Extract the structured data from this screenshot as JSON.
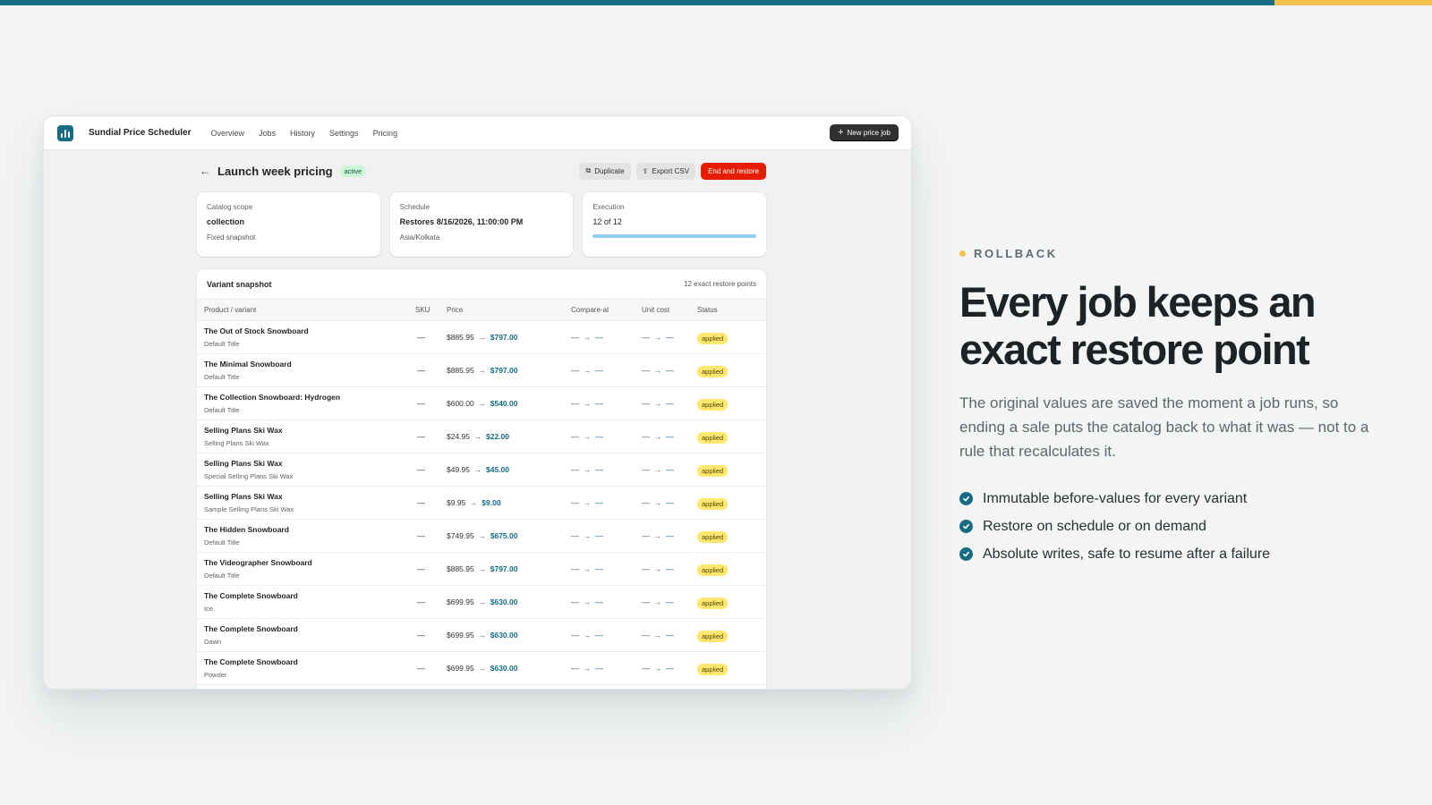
{
  "colors": {
    "brand": "#176b82",
    "accent": "#f2c14e",
    "critical": "#e51c00",
    "active_badge": "#cdf6d8",
    "status_badge": "#ffe770"
  },
  "app": {
    "name": "Sundial Price Scheduler",
    "nav": [
      "Overview",
      "Jobs",
      "History",
      "Settings",
      "Pricing"
    ],
    "new_job_label": "New price job"
  },
  "job": {
    "title": "Launch week pricing",
    "status": "active",
    "actions": {
      "duplicate": "Duplicate",
      "export": "Export CSV",
      "end": "End and restore"
    },
    "cards": {
      "scope": {
        "label": "Catalog scope",
        "value": "collection",
        "sub": "Fixed snapshot"
      },
      "schedule": {
        "label": "Schedule",
        "value": "Restores 8/16/2026, 11:00:00 PM",
        "sub": "Asia/Kolkata"
      },
      "execution": {
        "label": "Execution",
        "value": "12 of 12",
        "progress": 1.0
      }
    }
  },
  "snapshot": {
    "title": "Variant snapshot",
    "count": "12 exact restore points",
    "columns": {
      "product": "Product / variant",
      "sku": "SKU",
      "price": "Price",
      "compare": "Compare-at",
      "cost": "Unit cost",
      "status": "Status"
    },
    "dash": "—",
    "arrow": "→",
    "rows": [
      {
        "name": "The Out of Stock Snowboard",
        "variant": "Default Title",
        "old": "$885.95",
        "new": "$797.00",
        "status": "applied"
      },
      {
        "name": "The Minimal Snowboard",
        "variant": "Default Title",
        "old": "$885.95",
        "new": "$797.00",
        "status": "applied"
      },
      {
        "name": "The Collection Snowboard: Hydrogen",
        "variant": "Default Title",
        "old": "$600.00",
        "new": "$540.00",
        "status": "applied"
      },
      {
        "name": "Selling Plans Ski Wax",
        "variant": "Selling Plans Ski Wax",
        "old": "$24.95",
        "new": "$22.00",
        "status": "applied"
      },
      {
        "name": "Selling Plans Ski Wax",
        "variant": "Special Selling Plans Ski Wax",
        "old": "$49.95",
        "new": "$45.00",
        "status": "applied"
      },
      {
        "name": "Selling Plans Ski Wax",
        "variant": "Sample Selling Plans Ski Wax",
        "old": "$9.95",
        "new": "$9.00",
        "status": "applied"
      },
      {
        "name": "The Hidden Snowboard",
        "variant": "Default Title",
        "old": "$749.95",
        "new": "$675.00",
        "status": "applied"
      },
      {
        "name": "The Videographer Snowboard",
        "variant": "Default Title",
        "old": "$885.95",
        "new": "$797.00",
        "status": "applied"
      },
      {
        "name": "The Complete Snowboard",
        "variant": "Ice",
        "old": "$699.95",
        "new": "$630.00",
        "status": "applied"
      },
      {
        "name": "The Complete Snowboard",
        "variant": "Dawn",
        "old": "$699.95",
        "new": "$630.00",
        "status": "applied"
      },
      {
        "name": "The Complete Snowboard",
        "variant": "Powder",
        "old": "$699.95",
        "new": "$630.00",
        "status": "applied"
      }
    ]
  },
  "marketing": {
    "eyebrow": "ROLLBACK",
    "headline": "Every job keeps an exact restore point",
    "body": "The original values are saved the moment a job runs, so ending a sale puts the catalog back to what it was — not to a rule that recalculates it.",
    "bullets": [
      "Immutable before-values for every variant",
      "Restore on schedule or on demand",
      "Absolute writes, safe to resume after a failure"
    ]
  }
}
